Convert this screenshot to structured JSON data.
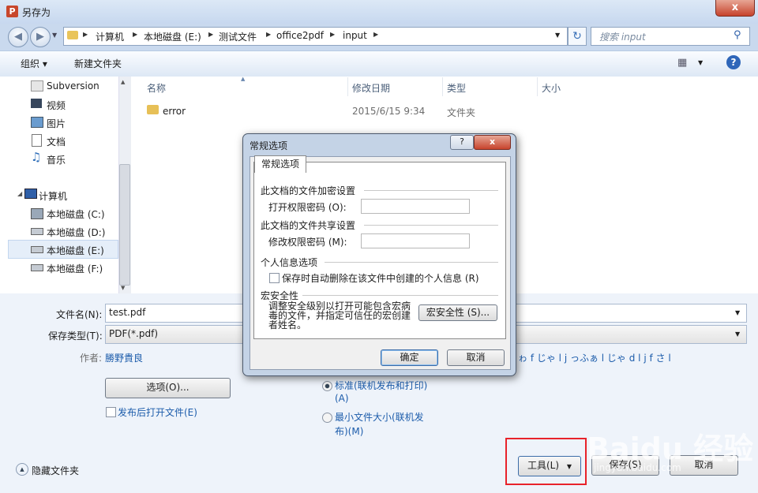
{
  "window": {
    "title": "另存为",
    "close": "x"
  },
  "address": {
    "segments": [
      "计算机",
      "本地磁盘 (E:)",
      "测试文件",
      "office2pdf",
      "input"
    ],
    "search_placeholder": "搜索 input"
  },
  "toolbar": {
    "organize": "组织 ▾",
    "new_folder": "新建文件夹",
    "help": "?"
  },
  "nav": {
    "favorites": [
      {
        "label": "Subversion",
        "icon": "svn-icon"
      },
      {
        "label": "视频",
        "icon": "video-icon"
      },
      {
        "label": "图片",
        "icon": "picture-icon"
      },
      {
        "label": "文档",
        "icon": "document-icon"
      },
      {
        "label": "音乐",
        "icon": "music-icon"
      }
    ],
    "computer": "计算机",
    "drives": [
      "本地磁盘 (C:)",
      "本地磁盘 (D:)",
      "本地磁盘 (E:)",
      "本地磁盘 (F:)"
    ],
    "selected_drive": "本地磁盘 (E:)"
  },
  "files": {
    "columns": [
      "名称",
      "修改日期",
      "类型",
      "大小"
    ],
    "rows": [
      {
        "name": "error",
        "date": "2015/6/15 9:34",
        "type": "文件夹",
        "size": ""
      }
    ]
  },
  "form": {
    "filename_label": "文件名(N):",
    "filename_value": "test.pdf",
    "filetype_label": "保存类型(T):",
    "filetype_value": "PDF(*.pdf)",
    "author_label": "作者:",
    "author_value": "勝野貴良",
    "tags_tail": "ゎ f じゃ l j っふぁ l じゃ d l j f さ l",
    "options_button": "选项(O)...",
    "open_after_publish": "发布后打开文件(E)",
    "radio_standard": "标准(联机发布和打印)",
    "radio_standard_sub": "(A)",
    "radio_min": "最小文件大小(联机发",
    "radio_min_sub": "布)(M)",
    "hide_folders": "隐藏文件夹",
    "tools_button": "工具(L)",
    "save_button": "保存(S)",
    "cancel_button": "取消"
  },
  "dialog": {
    "title": "常规选项",
    "help": "?",
    "close": "x",
    "tab": "常规选项",
    "encrypt_group": "此文档的文件加密设置",
    "open_password_label": "打开权限密码 (O):",
    "share_group": "此文档的文件共享设置",
    "modify_password_label": "修改权限密码 (M):",
    "privacy_group": "个人信息选项",
    "remove_personal_info": "保存时自动删除在该文件中创建的个人信息 (R)",
    "macro_group": "宏安全性",
    "macro_text": "调整安全级别以打开可能包含宏病毒的文件，并指定可信任的宏创建者姓名。",
    "macro_button": "宏安全性 (S)...",
    "ok_button": "确定",
    "cancel_button": "取消"
  },
  "watermark": {
    "brand": "Baidu 经验",
    "url": "jingyan.baidu.com"
  }
}
